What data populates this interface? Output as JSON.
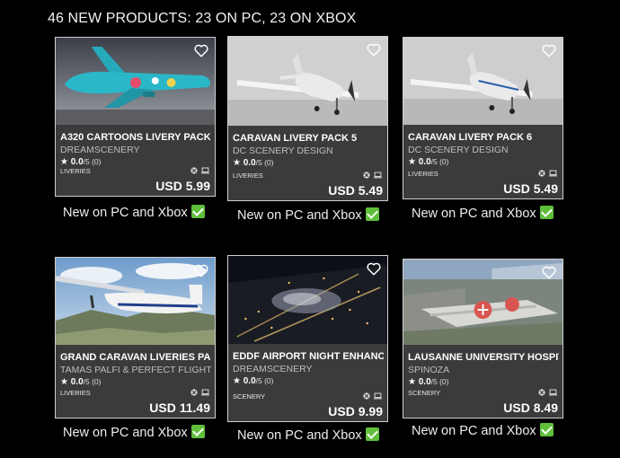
{
  "header": {
    "title": "46 NEW PRODUCTS: 23 ON PC, 23 ON XBOX"
  },
  "caption_text": "New on PC and Xbox",
  "products": [
    {
      "title": "A320 CARTOONS LIVERY PACK",
      "creator": "DREAMSCENERY",
      "rating": "0.0",
      "rating_max": "/5 (0)",
      "category": "LIVERIES",
      "price": "USD 5.99"
    },
    {
      "title": "CARAVAN LIVERY PACK 5",
      "creator": "DC SCENERY DESIGN",
      "rating": "0.0",
      "rating_max": "/5 (0)",
      "category": "LIVERIES",
      "price": "USD 5.49"
    },
    {
      "title": "CARAVAN LIVERY PACK 6",
      "creator": "DC SCENERY DESIGN",
      "rating": "0.0",
      "rating_max": "/5 (0)",
      "category": "LIVERIES",
      "price": "USD 5.49"
    },
    {
      "title": "GRAND CARAVAN LIVERIES PACK",
      "creator": "TAMAS PALFI & PERFECT FLIGHT",
      "rating": "0.0",
      "rating_max": "/5 (0)",
      "category": "LIVERIES",
      "price": "USD 11.49"
    },
    {
      "title": "EDDF AIRPORT NIGHT ENHANCED",
      "creator": "DREAMSCENERY",
      "rating": "0.0",
      "rating_max": "/5 (0)",
      "category": "SCENERY",
      "price": "USD 9.99"
    },
    {
      "title": "LAUSANNE UNIVERSITY HOSPITAL",
      "creator": "SPINOZA",
      "rating": "0.0",
      "rating_max": "/5 (0)",
      "category": "SCENERY",
      "price": "USD 8.49"
    }
  ],
  "icons": {
    "wishlist": "heart-icon",
    "star": "star-icon",
    "xbox": "xbox-icon",
    "pc": "pc-icon",
    "check": "check-icon"
  },
  "colors": {
    "background": "#000000",
    "card": "#3a3a3a",
    "check": "#5fbf3a"
  }
}
